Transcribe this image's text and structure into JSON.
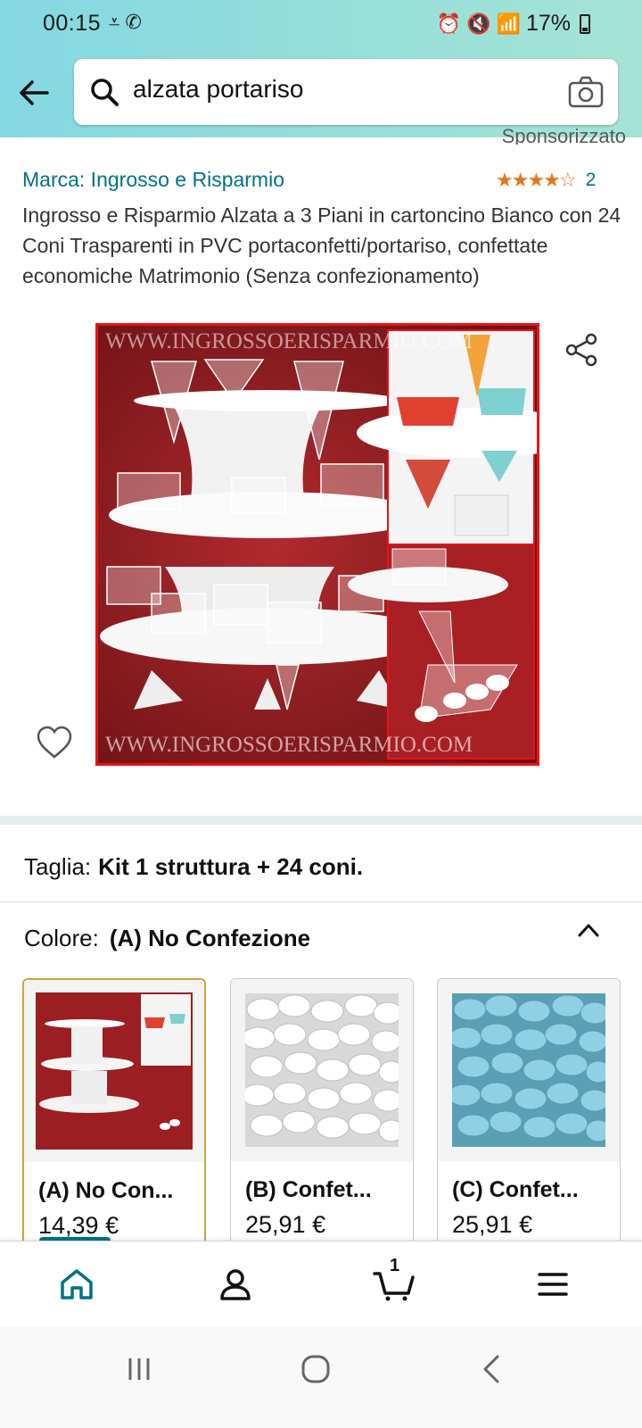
{
  "status": {
    "time": "00:15",
    "battery": "17%"
  },
  "search": {
    "query": "alzata portariso"
  },
  "sponsored": "Sponsorizzato",
  "product": {
    "brand": "Marca: Ingrosso e Risparmio",
    "rating_stars": "★★★★☆",
    "rating_count": "2",
    "title": "Ingrosso e Risparmio Alzata a 3 Piani in cartoncino Bianco con 24 Coni Trasparenti in PVC portaconfetti/portariso, confettate economiche Matrimonio (Senza confezionamento)",
    "watermark": "WWW.INGROSSOERISPARMIO.COM"
  },
  "taglia": {
    "label": "Taglia:",
    "value": "Kit 1 struttura + 24 coni."
  },
  "colore": {
    "label": "Colore:",
    "value": "(A) No Confezione"
  },
  "swatches": [
    {
      "label": "(A) No Con...",
      "price": "14,39 €",
      "selected": true
    },
    {
      "label": "(B) Confet...",
      "price": "25,91 €",
      "color": "#ffffff"
    },
    {
      "label": "(C) Confet...",
      "price": "25,91 €",
      "color": "#8fd0e4"
    }
  ],
  "bottom_nav": {
    "cart_count": "1"
  },
  "icons": [
    "back-arrow-icon",
    "search-icon",
    "camera-icon",
    "share-icon",
    "heart-icon",
    "chevron-up-icon",
    "home-icon",
    "account-icon",
    "cart-icon",
    "menu-icon"
  ],
  "colors": {
    "header_start": "#84d8e2",
    "header_end": "#a5e4d4",
    "link": "#007185",
    "star": "#de7921",
    "selected_border": "#d2a23c",
    "photo_bg": "#8c1c20"
  }
}
